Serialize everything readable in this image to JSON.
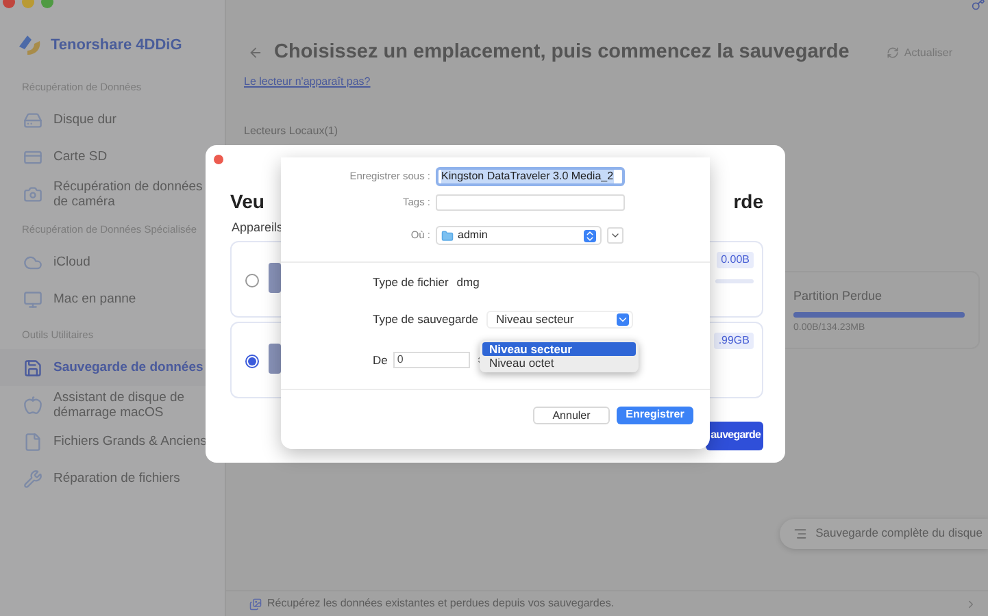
{
  "app_title": "Tenorshare 4DDiG",
  "sidebar": [
    {
      "heading": "Récupération de Données",
      "items": [
        {
          "label": "Disque dur",
          "selected": false
        },
        {
          "label": "Carte SD",
          "selected": false
        },
        {
          "label": "Récupération de données de caméra",
          "selected": false
        }
      ]
    },
    {
      "heading": "Récupération de Données Spécialisée",
      "items": [
        {
          "label": "iCloud",
          "selected": false
        },
        {
          "label": "Mac en panne",
          "selected": false
        }
      ]
    },
    {
      "heading": "Outils Utilitaires",
      "items": [
        {
          "label": "Sauvegarde de données",
          "selected": true
        },
        {
          "label": "Assistant de disque de démarrage macOS",
          "selected": false
        },
        {
          "label": "Fichiers Grands & Anciens",
          "selected": false
        },
        {
          "label": "Réparation de fichiers",
          "selected": false
        }
      ]
    }
  ],
  "main": {
    "title": "Choisissez un emplacement, puis commencez la sauvegarde",
    "refresh_label": "Actualiser",
    "help_link": "Le lecteur n'apparaît pas?",
    "local_drives_label": "Lecteurs Locaux(1)",
    "partition": {
      "name": "Partition Perdue",
      "level": 1,
      "size": "0.00B/134.23MB"
    },
    "full_backup_button": "Sauvegarde complète du disque",
    "footer": "Récupérez les données existantes et perdues depuis vos sauvegardes."
  },
  "modal": {
    "title_start": "Veu",
    "title_end": "rde",
    "devices_label": "Appareils",
    "devices": [
      {
        "selected": false,
        "size": "0.00B",
        "level": 0
      },
      {
        "selected": true,
        "size": ".99GB"
      }
    ],
    "primary_button": "auvegarde"
  },
  "save_sheet": {
    "save_as_label": "Enregistrer sous :",
    "save_as_value": "Kingston DataTraveler 3.0 Media_2",
    "tags_label": "Tags :",
    "where_label": "Où :",
    "where_value": "admin",
    "file_type_label": "Type de fichier",
    "file_type_value": "dmg",
    "backup_type_label": "Type de sauvegarde",
    "backup_type_value": "Niveau secteur",
    "backup_type_options": [
      {
        "label": "Niveau secteur",
        "selected": true
      },
      {
        "label": "Niveau octet",
        "selected": false
      }
    ],
    "from_label": "De",
    "from_value": "0",
    "buttons": [
      {
        "label": "Annuler",
        "kind": "secondary"
      },
      {
        "label": "Enregistrer",
        "kind": "primary"
      }
    ]
  }
}
